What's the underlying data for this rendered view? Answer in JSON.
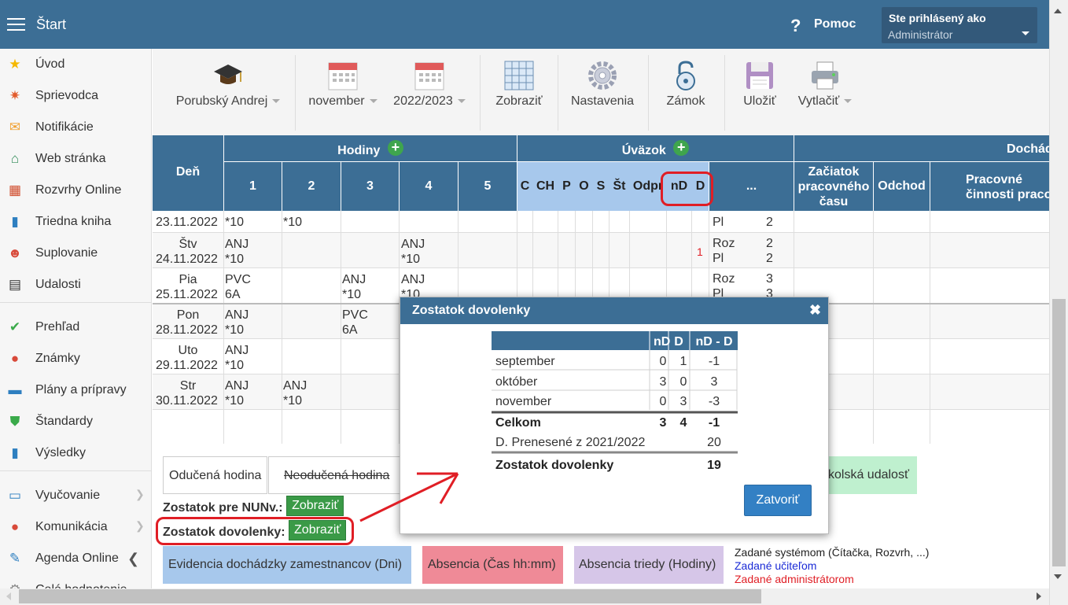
{
  "topbar": {
    "title": "Štart",
    "help": "Pomoc",
    "help_icon": "?",
    "user_line1": "Ste prihlásený ako",
    "user_line2": "Administrátor"
  },
  "sidebar": {
    "items": [
      {
        "label": "Úvod",
        "icon": "star-icon",
        "color": "#f5b800",
        "glyph": "★"
      },
      {
        "label": "Sprievodca",
        "icon": "magic-wand-icon",
        "color": "#e25b2c",
        "glyph": "✷"
      },
      {
        "label": "Notifikácie",
        "icon": "envelope-icon",
        "color": "#f0a030",
        "glyph": "✉"
      },
      {
        "label": "Web stránka",
        "icon": "house-icon",
        "color": "#2e8b57",
        "glyph": "⌂"
      },
      {
        "label": "Rozvrhy Online",
        "icon": "timetable-icon",
        "color": "#d04a2a",
        "glyph": "▦"
      },
      {
        "label": "Triedna kniha",
        "icon": "book-icon",
        "color": "#2e7fc0",
        "glyph": "▮"
      },
      {
        "label": "Suplovanie",
        "icon": "person-icon",
        "color": "#d84a3a",
        "glyph": "☻"
      },
      {
        "label": "Udalosti",
        "icon": "calendar-icon",
        "color": "#333",
        "glyph": "▤"
      },
      {
        "label": "Prehľad",
        "icon": "check-circle-icon",
        "color": "#3aaa4a",
        "glyph": "✔"
      },
      {
        "label": "Známky",
        "icon": "grades-icon",
        "color": "#d84a3a",
        "glyph": "●"
      },
      {
        "label": "Plány a prípravy",
        "icon": "briefcase-icon",
        "color": "#2e7fc0",
        "glyph": "▬"
      },
      {
        "label": "Štandardy",
        "icon": "shield-icon",
        "color": "#3aaa4a",
        "glyph": "⛊"
      },
      {
        "label": "Výsledky",
        "icon": "bar-chart-icon",
        "color": "#2e7fc0",
        "glyph": "▮"
      },
      {
        "label": "Vyučovanie",
        "icon": "open-book-icon",
        "color": "#2e7fc0",
        "glyph": "▭"
      },
      {
        "label": "Komunikácia",
        "icon": "chat-icon",
        "color": "#d84a3a",
        "glyph": "●"
      },
      {
        "label": "Agenda Online",
        "icon": "pencil-icon",
        "color": "#2e7fc0",
        "glyph": "✎"
      },
      {
        "label": "Celé hodnotenie",
        "icon": "gear-icon",
        "color": "#888",
        "glyph": "⚙"
      }
    ]
  },
  "toolbar": {
    "teacher": "Porubský Andrej",
    "month": "november",
    "year": "2022/2023",
    "show": "Zobraziť",
    "settings": "Nastavenia",
    "lock": "Zámok",
    "save": "Uložiť",
    "print": "Vytlačiť"
  },
  "table": {
    "col_day": "Deň",
    "group_hours": "Hodiny",
    "group_load": "Úväzok",
    "group_attendance": "Dochádza",
    "hour_cols": [
      "1",
      "2",
      "3",
      "4",
      "5"
    ],
    "load_cols": [
      "C",
      "CH",
      "P",
      "O",
      "S",
      "Št",
      "Odpr",
      "nD",
      "D"
    ],
    "more": "...",
    "att_cols": [
      "Začiatok pracovného času",
      "Odchod",
      "Pracovné činnosti pracovn"
    ],
    "plus": "+",
    "rows": [
      {
        "day": "",
        "date": "23.11.2022",
        "h1": "*10",
        "h2": "*10",
        "h3": "",
        "h4": "",
        "h1b": "",
        "h2b": "",
        "h3b": "",
        "h4b": "",
        "ndval": "",
        "m1": "Pl",
        "n1": "2",
        "m2": "",
        "n2": ""
      },
      {
        "day": "Štv",
        "date": "24.11.2022",
        "h1": "ANJ",
        "h1b": "*10",
        "h2": "",
        "h2b": "",
        "h3": "",
        "h3b": "",
        "h4": "ANJ",
        "h4b": "*10",
        "ndval": "1",
        "m1": "Roz",
        "n1": "2",
        "m2": "Pl",
        "n2": "2"
      },
      {
        "day": "Pia",
        "date": "25.11.2022",
        "h1": "PVC",
        "h1b": "6A",
        "h2": "",
        "h2b": "",
        "h3": "ANJ",
        "h3b": "*10",
        "h4": "ANJ",
        "h4b": "*10",
        "ndval": "",
        "m1": "Roz",
        "n1": "3",
        "m2": "Pl",
        "n2": "3"
      },
      {
        "day": "Pon",
        "date": "28.11.2022",
        "h1": "ANJ",
        "h1b": "*10",
        "h2": "",
        "h2b": "",
        "h3": "PVC",
        "h3b": "6A",
        "h4": "",
        "h4b": "",
        "ndval": "",
        "m1": "",
        "n1": "",
        "m2": "",
        "n2": ""
      },
      {
        "day": "Uto",
        "date": "29.11.2022",
        "h1": "ANJ",
        "h1b": "*10",
        "h2": "",
        "h2b": "",
        "h3": "",
        "h3b": "",
        "h4": "",
        "h4b": "",
        "ndval": "",
        "m1": "",
        "n1": "",
        "m2": "",
        "n2": ""
      },
      {
        "day": "Str",
        "date": "30.11.2022",
        "h1": "ANJ",
        "h1b": "*10",
        "h2": "ANJ",
        "h2b": "*10",
        "h3": "",
        "h3b": "",
        "h4": "",
        "h4b": "",
        "ndval": "",
        "m1": "",
        "n1": "",
        "m2": "",
        "n2": ""
      }
    ]
  },
  "legend": {
    "taught": "Odučená hodina",
    "not_taught": "Neodučená hodina",
    "school_event": "kolská udalosť",
    "nunv_label": "Zostatok pre NUNv.:",
    "nunv_btn": "Zobraziť",
    "vac_label": "Zostatok dovolenky:",
    "vac_btn": "Zobraziť",
    "attendance_days": "Evidencia dochádzky zamestnancov (Dni)",
    "absence_time": "Absencia (Čas hh:mm)",
    "absence_class": "Absencia triedy (Hodiny)",
    "by_system": "Zadané systémom (Čítačka, Rozvrh, ...)",
    "by_teacher": "Zadané učiteľom",
    "by_admin": "Zadané administrátorom"
  },
  "dialog": {
    "title": "Zostatok dovolenky",
    "close": "✖",
    "headers": [
      "",
      "nD",
      "D",
      "nD - D"
    ],
    "rows": [
      {
        "month": "september",
        "nd": "0",
        "d": "1",
        "diff": "-1"
      },
      {
        "month": "október",
        "nd": "3",
        "d": "0",
        "diff": "3"
      },
      {
        "month": "november",
        "nd": "0",
        "d": "3",
        "diff": "-3"
      }
    ],
    "total_label": "Celkom",
    "total_nd": "3",
    "total_d": "4",
    "total_diff": "-1",
    "carried_label": "D. Prenesené z 2021/2022",
    "carried_val": "20",
    "balance_label": "Zostatok dovolenky",
    "balance_val": "19",
    "close_btn": "Zatvoriť"
  },
  "colors": {
    "header_blue": "#3c6e95",
    "highlight_blue": "#a7c8ec",
    "green": "#3a9a47",
    "annotation_red": "#e01e25"
  }
}
